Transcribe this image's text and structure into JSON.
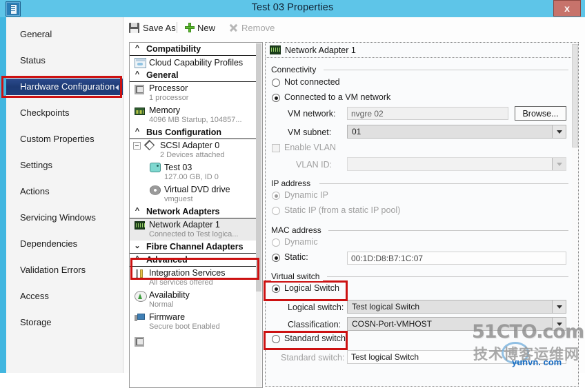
{
  "window": {
    "title": "Test 03 Properties",
    "close_label": "x",
    "icon": "document-properties-icon"
  },
  "sidebar": {
    "items": [
      {
        "label": "General",
        "selected": false
      },
      {
        "label": "Status",
        "selected": false
      },
      {
        "label": "Hardware Configuration",
        "selected": true
      },
      {
        "label": "Checkpoints",
        "selected": false
      },
      {
        "label": "Custom Properties",
        "selected": false
      },
      {
        "label": "Settings",
        "selected": false
      },
      {
        "label": "Actions",
        "selected": false
      },
      {
        "label": "Servicing Windows",
        "selected": false
      },
      {
        "label": "Dependencies",
        "selected": false
      },
      {
        "label": "Validation Errors",
        "selected": false
      },
      {
        "label": "Access",
        "selected": false
      },
      {
        "label": "Storage",
        "selected": false
      }
    ]
  },
  "toolbar": {
    "save_as": "Save As",
    "new": "New",
    "remove": "Remove"
  },
  "tree": {
    "groups": [
      {
        "label": "Compatibility",
        "expanded": true,
        "nodes": [
          {
            "title": "Cloud Capability Profiles",
            "sub": "",
            "icon": "cloud-profile-icon"
          }
        ]
      },
      {
        "label": "General",
        "expanded": true,
        "nodes": [
          {
            "title": "Processor",
            "sub": "1 processor",
            "icon": "processor-icon"
          },
          {
            "title": "Memory",
            "sub": "4096 MB Startup, 104857...",
            "icon": "memory-icon"
          }
        ]
      },
      {
        "label": "Bus Configuration",
        "expanded": true,
        "nodes": [
          {
            "title": "SCSI Adapter 0",
            "sub": "2 Devices attached",
            "icon": "scsi-adapter-icon"
          },
          {
            "title": "Test 03",
            "sub": "127.00 GB, ID 0",
            "icon": "virtual-hard-disk-icon"
          },
          {
            "title": "Virtual DVD drive",
            "sub": "vmguest",
            "icon": "dvd-drive-icon"
          }
        ]
      },
      {
        "label": "Network Adapters",
        "expanded": true,
        "nodes": [
          {
            "title": "Network Adapter 1",
            "sub": "Connected to Test  logica...",
            "icon": "network-adapter-icon",
            "selected": true,
            "highlighted": true
          }
        ]
      },
      {
        "label": "Fibre Channel Adapters",
        "expanded": false,
        "nodes": []
      },
      {
        "label": "Advanced",
        "expanded": true,
        "nodes": [
          {
            "title": "Integration Services",
            "sub": "All services offered",
            "icon": "integration-services-icon"
          },
          {
            "title": "Availability",
            "sub": "Normal",
            "icon": "availability-icon"
          },
          {
            "title": "Firmware",
            "sub": "Secure boot Enabled",
            "icon": "firmware-icon"
          }
        ]
      }
    ]
  },
  "detail": {
    "header": "Network Adapter 1",
    "header_icon": "network-adapter-icon",
    "connectivity": {
      "group_label": "Connectivity",
      "not_connected": {
        "label": "Not connected",
        "selected": false
      },
      "connected_vm_network": {
        "label": "Connected to a VM network",
        "selected": true
      },
      "vm_network_label": "VM network:",
      "vm_network_value": "nvgre 02",
      "browse_button": "Browse...",
      "vm_subnet_label": "VM subnet:",
      "vm_subnet_value": "01",
      "enable_vlan_label": "Enable VLAN",
      "enable_vlan_checked": false,
      "vlan_id_label": "VLAN ID:",
      "vlan_id_value": ""
    },
    "ip_address": {
      "group_label": "IP address",
      "dynamic": {
        "label": "Dynamic IP",
        "selected": true
      },
      "static_pool": {
        "label": "Static IP (from a static IP pool)",
        "selected": false
      }
    },
    "mac_address": {
      "group_label": "MAC address",
      "dynamic": {
        "label": "Dynamic",
        "selected": false
      },
      "static": {
        "label": "Static:",
        "selected": true
      },
      "static_value": "00:1D:D8:B7:1C:07"
    },
    "virtual_switch": {
      "group_label": "Virtual switch",
      "logical_switch_radio": {
        "label": "Logical Switch",
        "selected": true
      },
      "logical_switch_label": "Logical switch:",
      "logical_switch_value": "Test  logical Switch",
      "classification_label": "Classification:",
      "classification_value": "COSN-Port-VMHOST",
      "standard_switch_radio": {
        "label": "Standard switch",
        "selected": false
      },
      "standard_switch_label": "Standard switch:",
      "standard_switch_value": "Test  logical Switch"
    }
  },
  "watermark": {
    "line1": "51CTO.com",
    "line2": "技术博客运维网",
    "line3": "yunvn. com"
  },
  "colors": {
    "titlebar": "#5ec5e8",
    "selection": "#1d3a74",
    "annotation_red": "#cc1111",
    "accent_green": "#5cbb2e"
  }
}
